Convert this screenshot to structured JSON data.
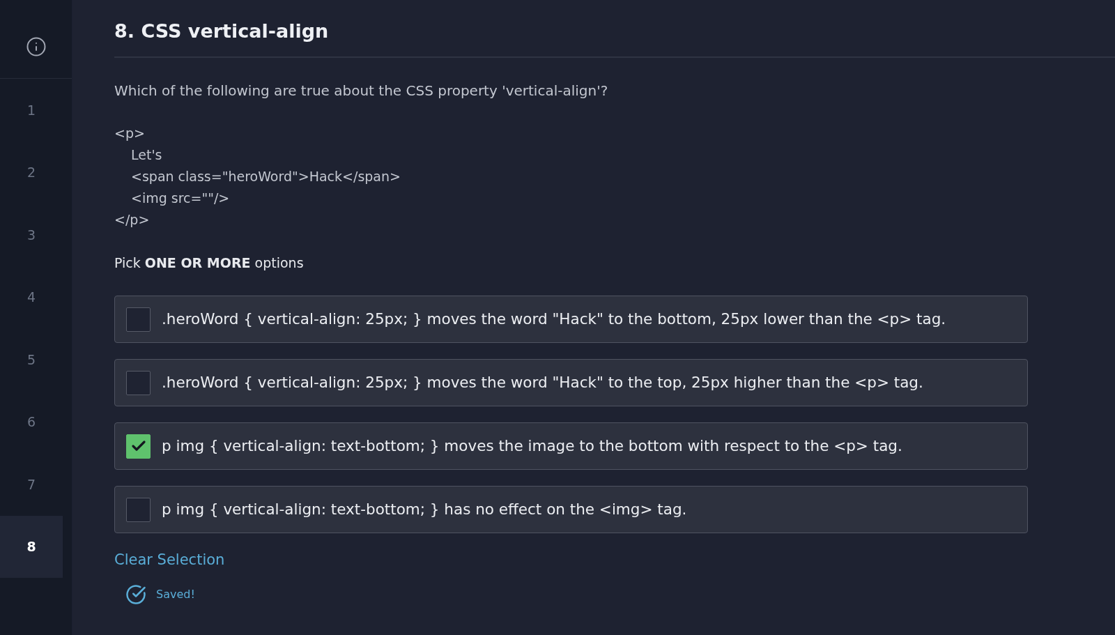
{
  "sidebar": {
    "items": [
      {
        "label": "1",
        "selected": false
      },
      {
        "label": "2",
        "selected": false
      },
      {
        "label": "3",
        "selected": false
      },
      {
        "label": "4",
        "selected": false
      },
      {
        "label": "5",
        "selected": false
      },
      {
        "label": "6",
        "selected": false
      },
      {
        "label": "7",
        "selected": false
      },
      {
        "label": "8",
        "selected": true
      }
    ]
  },
  "question": {
    "title": "8. CSS vertical-align",
    "prompt": "Which of the following are true about the CSS property 'vertical-align'?",
    "code": [
      {
        "line": "<p>",
        "children": [
          {
            "line": "Let's"
          },
          {
            "line": "<span class=\"heroWord\">Hack</span>"
          },
          {
            "line": "<img src=\"\"/>"
          }
        ]
      },
      {
        "line": "</p>"
      }
    ],
    "instruction": "Pick **ONE OR MORE** options"
  },
  "options": [
    {
      "text": ".heroWord { vertical-align: 25px; } moves the word \"Hack\" to the bottom, 25px lower than the <p> tag.",
      "checked": false
    },
    {
      "text": ".heroWord { vertical-align: 25px; } moves the word \"Hack\" to the top, 25px higher than the <p> tag.",
      "checked": false
    },
    {
      "text": "p img { vertical-align: text-bottom; } moves the image to the bottom with respect to the <p> tag.",
      "checked": true
    },
    {
      "text": "p img { vertical-align: text-bottom; } has no effect on the <img> tag.",
      "checked": false
    }
  ],
  "clear_selection": "Clear Selection",
  "status": "Saved!"
}
